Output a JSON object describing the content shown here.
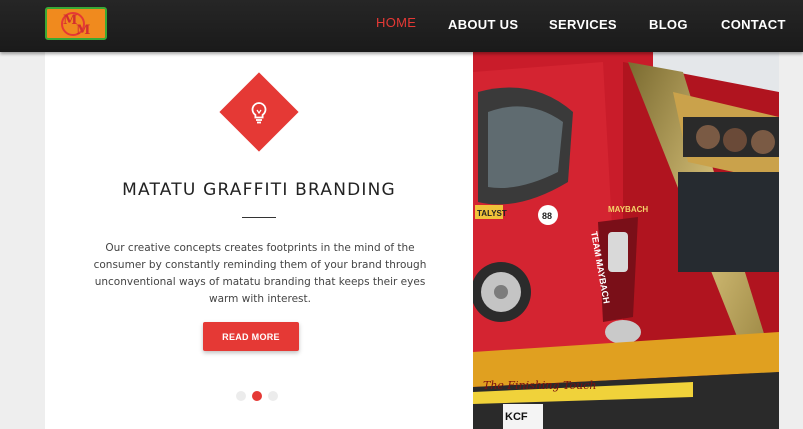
{
  "nav": {
    "logo_text": "M&M",
    "items": [
      {
        "label": "HOME",
        "active": true
      },
      {
        "label": "ABOUT US",
        "active": false
      },
      {
        "label": "SERVICES",
        "active": false
      },
      {
        "label": "BLOG",
        "active": false
      },
      {
        "label": "CONTACT",
        "active": false
      }
    ]
  },
  "hero": {
    "icon": "lightbulb-icon",
    "title": "MATATU GRAFFITI BRANDING",
    "description": "Our creative concepts creates footprints in the mind of the consumer by constantly reminding them of your brand through unconventional ways of matatu branding that keeps their eyes warm with interest.",
    "button_label": "READ MORE",
    "slider": {
      "count": 3,
      "active_index": 1
    }
  },
  "photo": {
    "subject": "graffiti-matatu-bus",
    "texts": [
      "MAYBACH",
      "TEAM MAYBACH",
      "TALYST",
      "88",
      "The Finishing Touch",
      "KCF"
    ]
  },
  "colors": {
    "accent": "#e53935",
    "nav_bg": "#1f1f1f",
    "logo_bg": "#f08a1e",
    "logo_border": "#3aa935"
  }
}
